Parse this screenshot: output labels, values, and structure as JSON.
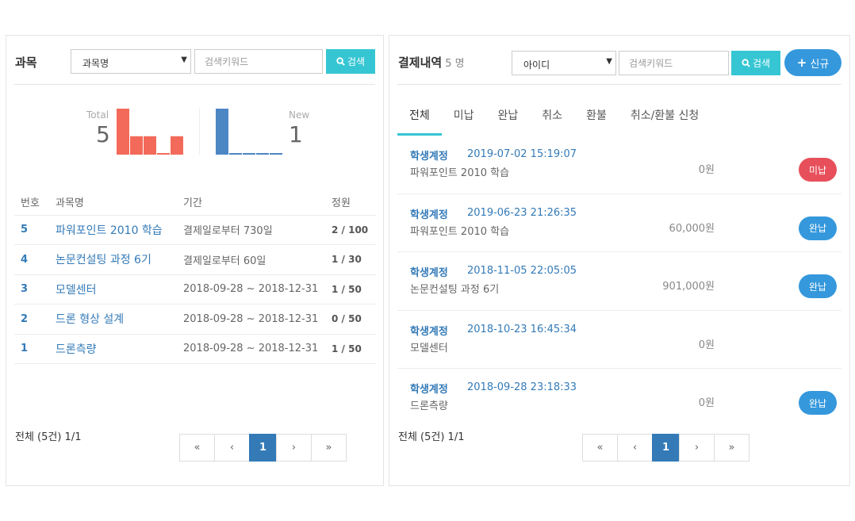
{
  "subjects": {
    "title": "과목",
    "filter_select": "과목명",
    "search_placeholder": "검색키워드",
    "search_label": "검색",
    "total_label": "Total",
    "total_value": "5",
    "new_label": "New",
    "new_value": "1",
    "columns": [
      "번호",
      "과목명",
      "기간",
      "정원"
    ],
    "rows": [
      {
        "num": "5",
        "name": "파워포인트 2010 학습",
        "period": "결제일로부터 730일",
        "capacity": "2 / 100"
      },
      {
        "num": "4",
        "name": "논문컨설팅 과정 6기",
        "period": "결제일로부터 60일",
        "capacity": "1 / 30"
      },
      {
        "num": "3",
        "name": "모델센터",
        "period": "2018-09-28 ~ 2018-12-31",
        "capacity": "1 / 50"
      },
      {
        "num": "2",
        "name": "드론 형상 설계",
        "period": "2018-09-28 ~ 2018-12-31",
        "capacity": "0 / 50"
      },
      {
        "num": "1",
        "name": "드론측량",
        "period": "2018-09-28 ~ 2018-12-31",
        "capacity": "1 / 50"
      }
    ],
    "footer": "전체 (5건) 1/1",
    "pager": {
      "first": "«",
      "prev": "‹",
      "current": "1",
      "next": "›",
      "last": "»"
    }
  },
  "chart_data": [
    {
      "type": "bar",
      "label": "Total",
      "values": [
        5,
        2,
        2,
        0,
        2
      ],
      "ylim": [
        0,
        5
      ],
      "color": "#f36a5a"
    },
    {
      "type": "bar",
      "label": "New",
      "values": [
        1,
        0,
        0,
        0,
        0
      ],
      "ylim": [
        0,
        1
      ],
      "color": "#4c87c4"
    }
  ],
  "payments": {
    "title": "결제내역",
    "count": "5 명",
    "filter_select": "아이디",
    "search_placeholder": "검색키워드",
    "search_label": "검색",
    "new_label": "신규",
    "tabs": [
      "전체",
      "미납",
      "완납",
      "취소",
      "환불",
      "취소/환불 신청"
    ],
    "items": [
      {
        "user": "학생계정",
        "date": "2019-07-02 15:19:07",
        "course": "파워포인트 2010 학습",
        "amount": "0원",
        "status": "미납"
      },
      {
        "user": "학생계정",
        "date": "2019-06-23 21:26:35",
        "course": "파워포인트 2010 학습",
        "amount": "60,000원",
        "status": "완납"
      },
      {
        "user": "학생계정",
        "date": "2018-11-05 22:05:05",
        "course": "논문컨설팅 과정 6기",
        "amount": "901,000원",
        "status": "완납"
      },
      {
        "user": "학생계정",
        "date": "2018-10-23 16:45:34",
        "course": "모델센터",
        "amount": "0원",
        "status": ""
      },
      {
        "user": "학생계정",
        "date": "2018-09-28 23:18:33",
        "course": "드론측량",
        "amount": "0원",
        "status": "완납"
      }
    ],
    "footer": "전체 (5건) 1/1",
    "pager": {
      "first": "«",
      "prev": "‹",
      "current": "1",
      "next": "›",
      "last": "»"
    }
  },
  "colors": {
    "unpaid": "#e7505a",
    "paid": "#3598dc",
    "accent": "#36c6d3",
    "link": "#337ab7"
  }
}
